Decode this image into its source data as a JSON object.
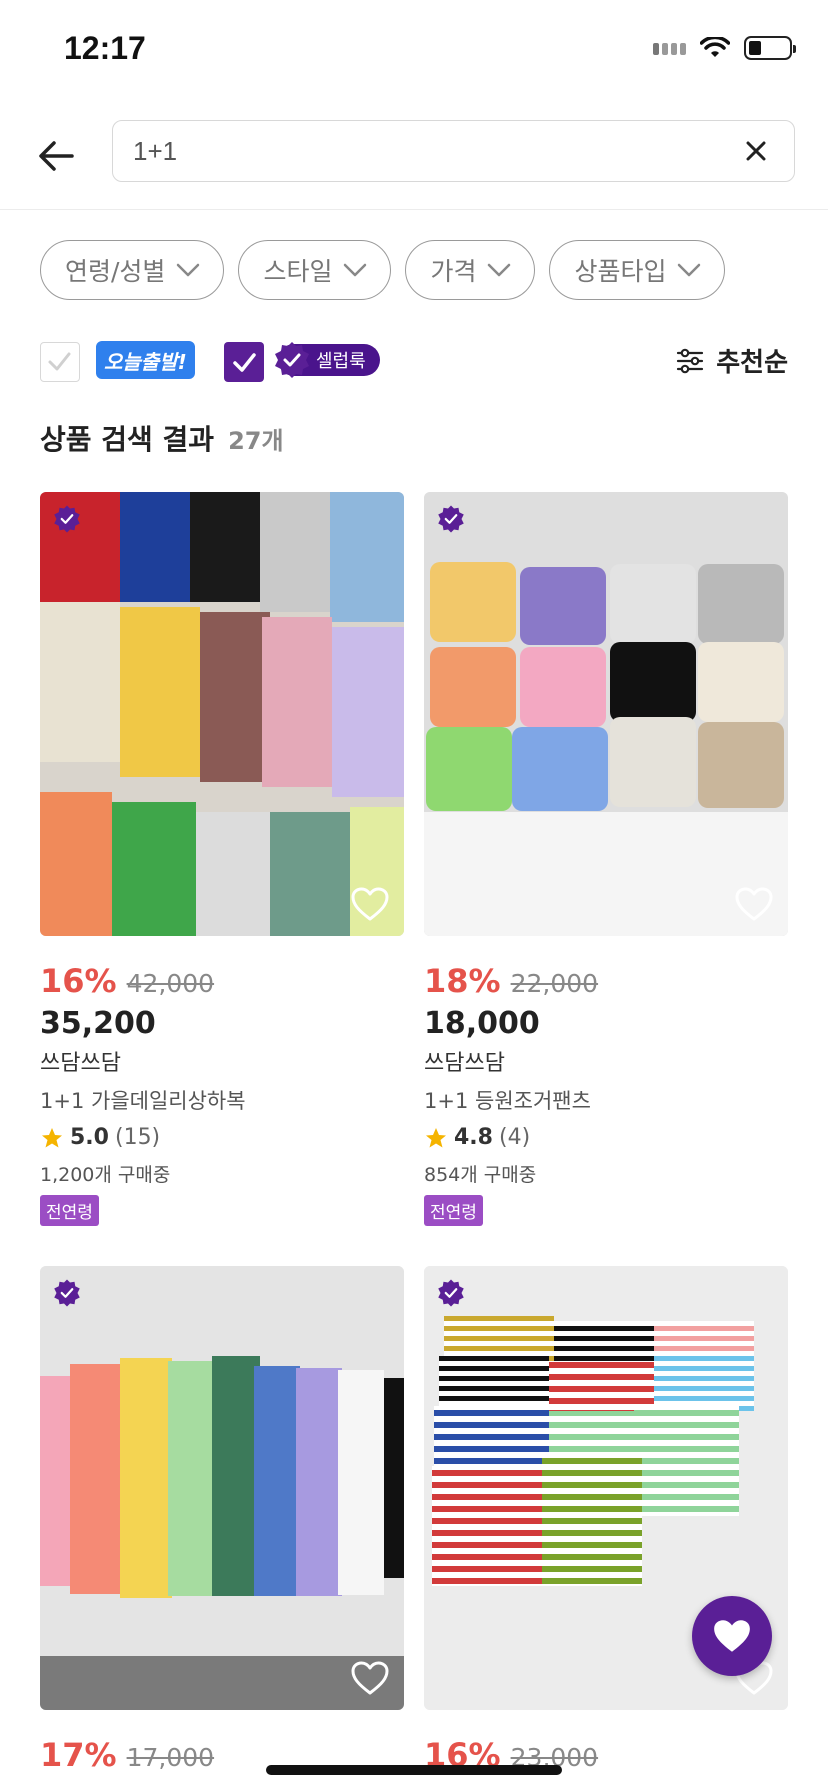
{
  "status_bar": {
    "time": "12:17"
  },
  "search": {
    "query": "1+1"
  },
  "filters": [
    {
      "label": "연령/성별"
    },
    {
      "label": "스타일"
    },
    {
      "label": "가격"
    },
    {
      "label": "상품타입"
    }
  ],
  "options": {
    "today_badge": "오늘출발!",
    "celeb_badge": "셀럽룩",
    "sort_label": "추천순"
  },
  "results": {
    "title": "상품 검색 결과",
    "count": "27개"
  },
  "products": [
    {
      "discount": "16%",
      "original_price": "42,000",
      "price": "35,200",
      "brand": "쓰담쓰담",
      "name": "1+1 가을데일리상하복",
      "rating": "5.0",
      "reviews": "(15)",
      "buyers": "1,200개 구매중",
      "tag": "전연령"
    },
    {
      "discount": "18%",
      "original_price": "22,000",
      "price": "18,000",
      "brand": "쓰담쓰담",
      "name": "1+1 등원조거팬츠",
      "rating": "4.8",
      "reviews": "(4)",
      "buyers": "854개 구매중",
      "tag": "전연령"
    },
    {
      "discount": "17%",
      "original_price": "17,000"
    },
    {
      "discount": "16%",
      "original_price": "23,000"
    }
  ],
  "colors": {
    "accent_purple": "#5a1f96",
    "discount_red": "#e5534b",
    "badge_blue": "#2f80ed",
    "tag_purple": "#9b4dc4"
  },
  "icons": [
    "back-arrow-icon",
    "close-icon",
    "chevron-down-icon",
    "check-icon",
    "verified-seal-icon",
    "sliders-icon",
    "star-icon",
    "heart-outline-icon",
    "heart-filled-icon",
    "wifi-icon",
    "battery-icon",
    "signal-icon"
  ]
}
